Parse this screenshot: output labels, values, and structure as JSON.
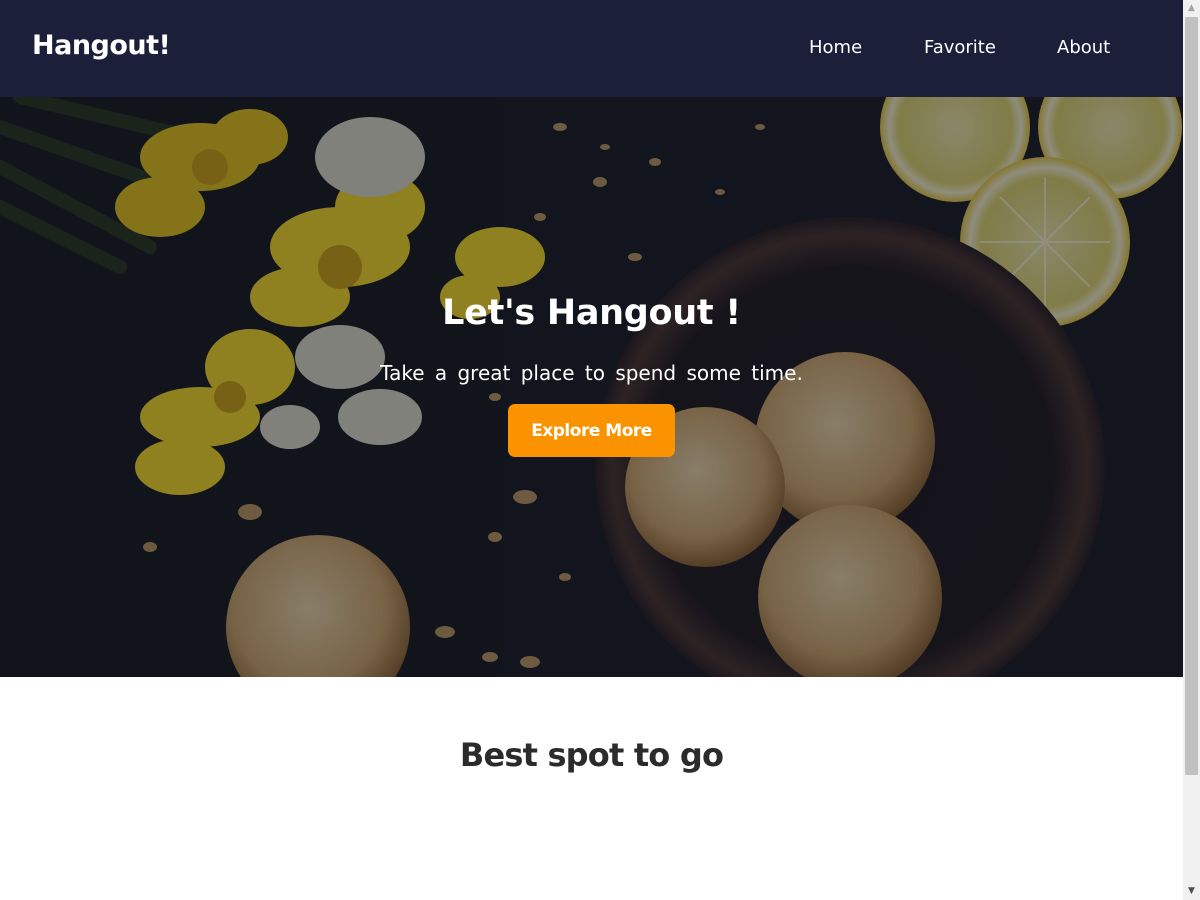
{
  "navbar": {
    "brand": "Hangout!",
    "links": [
      {
        "label": "Home"
      },
      {
        "label": "Favorite"
      },
      {
        "label": "About"
      }
    ],
    "background": "#1b1f3a"
  },
  "hero": {
    "title": "Let's Hangout !",
    "subtitle": "Take a great place to spend some time.",
    "button_label": "Explore More",
    "button_color": "#fb9300"
  },
  "section": {
    "title": "Best spot to go"
  },
  "scrollbar": {
    "up_icon": "scroll-up-arrow",
    "down_icon": "scroll-down-arrow"
  }
}
